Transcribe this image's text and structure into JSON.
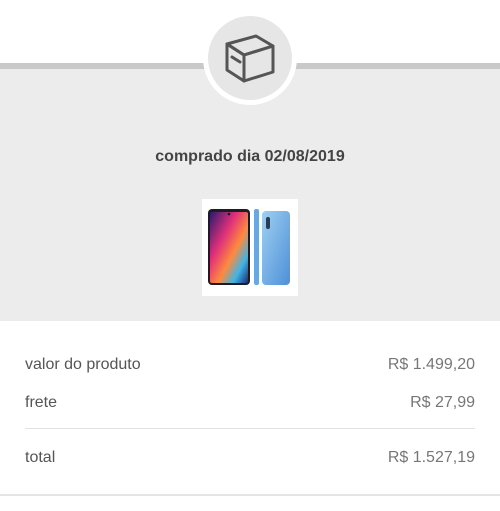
{
  "order": {
    "purchase_date_text": "comprado dia 02/08/2019",
    "box_icon": "package-box-icon",
    "product_image": "phone-product-thumbnail"
  },
  "summary": {
    "product_value_label": "valor do produto",
    "product_value": "R$ 1.499,20",
    "shipping_label": "frete",
    "shipping_value": "R$ 27,99",
    "total_label": "total",
    "total_value": "R$ 1.527,19"
  },
  "colors": {
    "band_background": "#ececec",
    "band_border": "#c9c9c9",
    "icon_stroke": "#555555"
  }
}
